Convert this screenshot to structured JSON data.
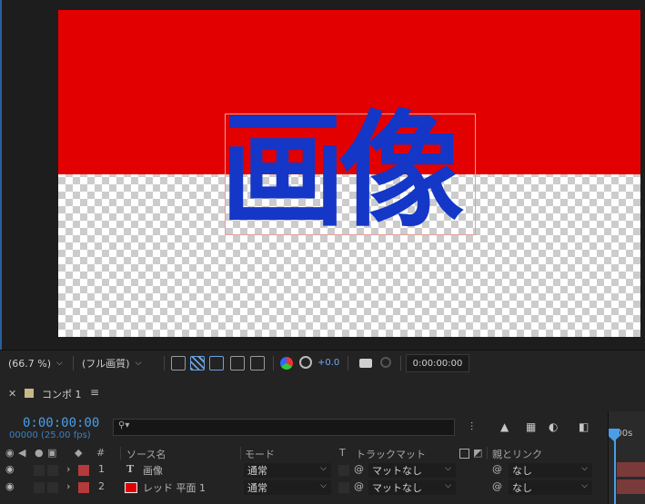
{
  "composition": {
    "text_layer_content": "画像",
    "background_color": "#e30000",
    "text_color": "#1437c7"
  },
  "viewer_toolbar": {
    "zoom_label": "(66.7 %)",
    "resolution_label": "(フル画質)",
    "exposure_value": "+0.0",
    "timecode": "0:00:00:00"
  },
  "timeline": {
    "tab_label": "コンポ 1",
    "current_time": "0:00:00:00",
    "frame_readout": "00000 (25.00 fps)",
    "search_placeholder": "",
    "ruler_label": ":00s",
    "columns": {
      "number": "#",
      "source_name": "ソース名",
      "mode": "モード",
      "t": "T",
      "track_matte": "トラックマット",
      "parent": "親とリンク"
    },
    "layers": [
      {
        "number": "1",
        "type_glyph": "T",
        "name": "画像",
        "mode": "通常",
        "matte": "マットなし",
        "parent": "なし",
        "label_color": "#b53a3a"
      },
      {
        "number": "2",
        "type_glyph": "",
        "name": "レッド 平面 1",
        "mode": "通常",
        "matte": "マットなし",
        "parent": "なし",
        "label_color": "#b53a3a"
      }
    ]
  },
  "icons": [
    "eye-icon",
    "speaker-icon",
    "solo-icon",
    "lock-icon",
    "label-tag-icon",
    "search-icon",
    "pickwhip-icon",
    "menu-icon",
    "close-icon",
    "camera-icon"
  ]
}
